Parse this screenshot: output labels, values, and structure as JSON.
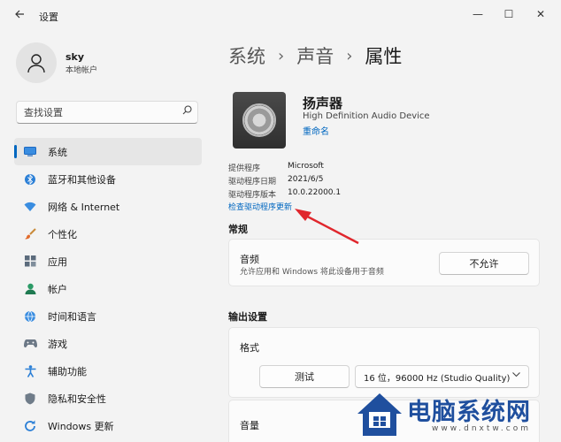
{
  "window": {
    "title": "设置",
    "back_icon": "back-arrow-icon",
    "minimize_glyph": "—",
    "maximize_glyph": "☐",
    "close_glyph": "✕"
  },
  "user": {
    "name": "sky",
    "account_type": "本地帐户"
  },
  "search": {
    "placeholder": "查找设置",
    "icon": "search-icon"
  },
  "nav": {
    "items": [
      {
        "label": "系统",
        "icon": "system-display-icon",
        "selected": true
      },
      {
        "label": "蓝牙和其他设备",
        "icon": "bluetooth-icon"
      },
      {
        "label": "网络 & Internet",
        "icon": "wifi-icon"
      },
      {
        "label": "个性化",
        "icon": "brush-icon"
      },
      {
        "label": "应用",
        "icon": "apps-icon"
      },
      {
        "label": "帐户",
        "icon": "person-icon"
      },
      {
        "label": "时间和语言",
        "icon": "globe-clock-icon"
      },
      {
        "label": "游戏",
        "icon": "gamepad-icon"
      },
      {
        "label": "辅助功能",
        "icon": "accessibility-icon"
      },
      {
        "label": "隐私和安全性",
        "icon": "shield-icon"
      },
      {
        "label": "Windows 更新",
        "icon": "update-icon"
      }
    ]
  },
  "breadcrumb": {
    "items": [
      "系统",
      "声音"
    ],
    "separator": "›",
    "current": "属性"
  },
  "device": {
    "name": "扬声器",
    "description": "High Definition Audio Device",
    "rename_label": "重命名"
  },
  "properties": [
    {
      "label": "提供程序",
      "value": "Microsoft"
    },
    {
      "label": "驱动程序日期",
      "value": "2021/6/5"
    },
    {
      "label": "驱动程序版本",
      "value": "10.0.22000.1"
    }
  ],
  "check_driver_label": "检查驱动程序更新",
  "general": {
    "section_title": "常规",
    "audio_title": "音频",
    "audio_desc": "允许应用和 Windows 将此设备用于音频",
    "disallow_label": "不允许"
  },
  "output": {
    "section_title": "输出设置",
    "format_title": "格式",
    "test_label": "测试",
    "format_value": "16 位，96000 Hz (Studio Quality)",
    "volume_title": "音量"
  },
  "watermark": {
    "title": "电脑系统网",
    "url": "www.dnxtw.com"
  },
  "colors": {
    "accent": "#0067c0",
    "annotation_arrow": "#e0262c",
    "watermark_blue": "#1f4f9e"
  }
}
